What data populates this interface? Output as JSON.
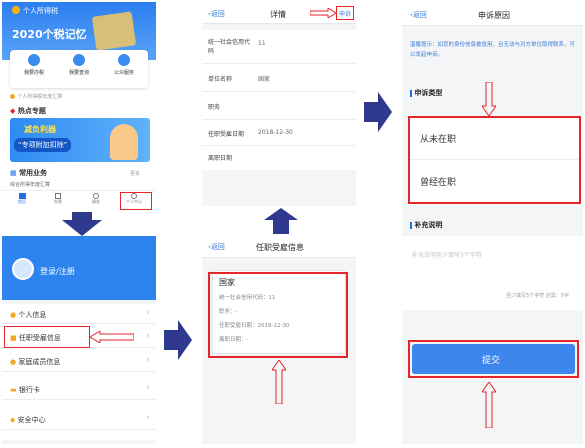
{
  "screen1": {
    "app_title": "个人所得税",
    "banner_title": "2020个税记忆",
    "shortcuts": [
      "我要办税",
      "我要查询",
      "公众服务"
    ],
    "notice": "个人所得税年度汇算",
    "hot_section_title": "热点专题",
    "promo_line1": "减负利器",
    "promo_line2": "“专项附加扣除”",
    "common_services_title": "常用业务",
    "common_services_more": "更多",
    "service_item": "综合所得年度汇算",
    "tabs": [
      "首页",
      "办税",
      "服务",
      "个人中心"
    ]
  },
  "screen2": {
    "login_label": "登录/注册",
    "menu": [
      "个人信息",
      "任职受雇信息",
      "家庭成员信息",
      "银行卡",
      "安全中心"
    ]
  },
  "screen3": {
    "back": "返回",
    "title": "任职受雇信息",
    "company": "国家",
    "fields": [
      {
        "label": "统一社会信用代码：",
        "value": "11"
      },
      {
        "label": "职务：",
        "value": "-"
      },
      {
        "label": "任职受雇日期：",
        "value": "2018-12-30"
      },
      {
        "label": "离职日期：",
        "value": "-"
      }
    ]
  },
  "screen4": {
    "back": "返回",
    "title": "详情",
    "appeal": "申诉",
    "rows": [
      {
        "label": "统一社会信用代码",
        "value": "11"
      },
      {
        "label": "单位名称",
        "value": "国家"
      },
      {
        "label": "职务",
        "value": ""
      },
      {
        "label": "任职受雇日期",
        "value": "2018-12-30"
      },
      {
        "label": "离职日期",
        "value": ""
      }
    ]
  },
  "screen5": {
    "back": "返回",
    "title": "申诉原因",
    "tip": "温馨提示：如您的身份信息被冒用，且无法与对方单位取得联系，可以发起申诉。",
    "type_title": "申诉类型",
    "options": [
      "从未在职",
      "曾经在职"
    ],
    "note_title": "补充说明",
    "note_placeholder": "补充说明至少填写5个字符",
    "counter": "至少填写5个字符 还需：5字",
    "submit": "提交"
  },
  "colors": {
    "brand_blue": "#1f6fe0",
    "highlight_red": "#e4262b",
    "arrow_navy": "#2f3a8f",
    "submit_blue": "#3d86ee"
  }
}
